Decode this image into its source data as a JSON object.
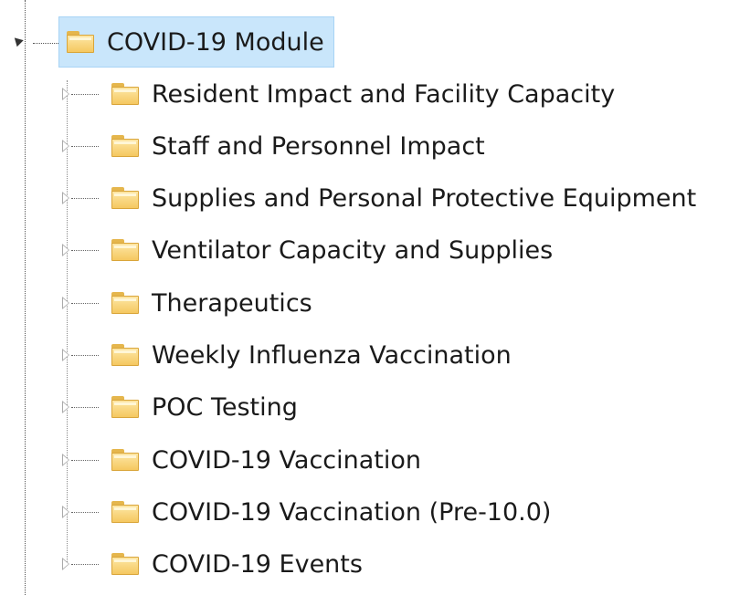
{
  "tree": {
    "root": {
      "label": "COVID-19 Module",
      "icon": "folder-open-icon",
      "expanded": true,
      "selected": true,
      "highlight_color": "#c9e6fb"
    },
    "children": [
      {
        "label": "Resident Impact and Facility Capacity",
        "icon": "folder-icon",
        "expanded": false
      },
      {
        "label": "Staff and Personnel Impact",
        "icon": "folder-icon",
        "expanded": false
      },
      {
        "label": "Supplies and Personal Protective Equipment",
        "icon": "folder-icon",
        "expanded": false
      },
      {
        "label": "Ventilator Capacity and Supplies",
        "icon": "folder-icon",
        "expanded": false
      },
      {
        "label": "Therapeutics",
        "icon": "folder-icon",
        "expanded": false
      },
      {
        "label": "Weekly Influenza Vaccination",
        "icon": "folder-icon",
        "expanded": false
      },
      {
        "label": "POC Testing",
        "icon": "folder-icon",
        "expanded": false
      },
      {
        "label": "COVID-19 Vaccination",
        "icon": "folder-icon",
        "expanded": false
      },
      {
        "label": "COVID-19 Vaccination (Pre-10.0)",
        "icon": "folder-icon",
        "expanded": false
      },
      {
        "label": "COVID-19 Events",
        "icon": "folder-icon",
        "expanded": false
      }
    ]
  }
}
